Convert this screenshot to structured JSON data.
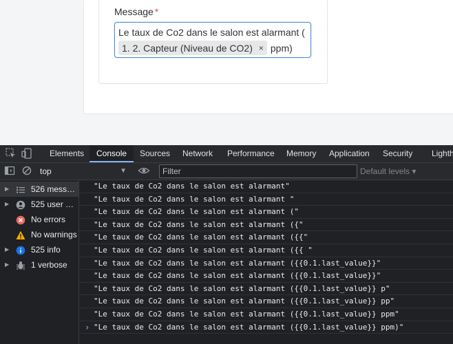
{
  "form": {
    "label": "Message",
    "required_mark": "*",
    "value_text": "Le taux de Co2 dans le salon est alarmant (",
    "token_label": "1. 2. Capteur (Niveau de CO2)",
    "token_remove": "×",
    "value_suffix": "ppm)"
  },
  "devtools": {
    "tabs": [
      "Elements",
      "Console",
      "Sources",
      "Network",
      "Performance",
      "Memory",
      "Application",
      "Security",
      "Lighthouse"
    ],
    "active_tab": "Console",
    "context": "top",
    "filter_placeholder": "Filter",
    "levels_label": "Default levels ▾",
    "sidebar": [
      {
        "label": "526 messa…",
        "icon": "list-icon"
      },
      {
        "label": "525 user m…",
        "icon": "user-icon"
      },
      {
        "label": "No errors",
        "icon": "error-icon"
      },
      {
        "label": "No warnings",
        "icon": "warning-icon"
      },
      {
        "label": "525 info",
        "icon": "info-icon"
      },
      {
        "label": "1 verbose",
        "icon": "bug-icon"
      }
    ],
    "log_lines": [
      "\"Le taux de Co2 dans le salon est alarmant\"",
      "\"Le taux de Co2 dans le salon est alarmant \"",
      "\"Le taux de Co2 dans le salon est alarmant (\"",
      "\"Le taux de Co2 dans le salon est alarmant ({\"",
      "\"Le taux de Co2 dans le salon est alarmant ({{\"",
      "\"Le taux de Co2 dans le salon est alarmant ({{ \"",
      "\"Le taux de Co2 dans le salon est alarmant ({{0.1.last_value}}\"",
      "\"Le taux de Co2 dans le salon est alarmant ({{0.1.last_value}}\"",
      "\"Le taux de Co2 dans le salon est alarmant ({{0.1.last_value}} p\"",
      "\"Le taux de Co2 dans le salon est alarmant ({{0.1.last_value}} pp\"",
      "\"Le taux de Co2 dans le salon est alarmant ({{0.1.last_value}} ppm\"",
      "\"Le taux de Co2 dans le salon est alarmant ({{0.1.last_value}} ppm)\""
    ],
    "prompt": "›"
  },
  "colors": {
    "required": "#d9534f",
    "focus_border": "#4a90d9",
    "active_tab_underline": "#8ab4f8",
    "error": "#e46962",
    "warning": "#f9ab00",
    "info": "#1a73e8"
  }
}
